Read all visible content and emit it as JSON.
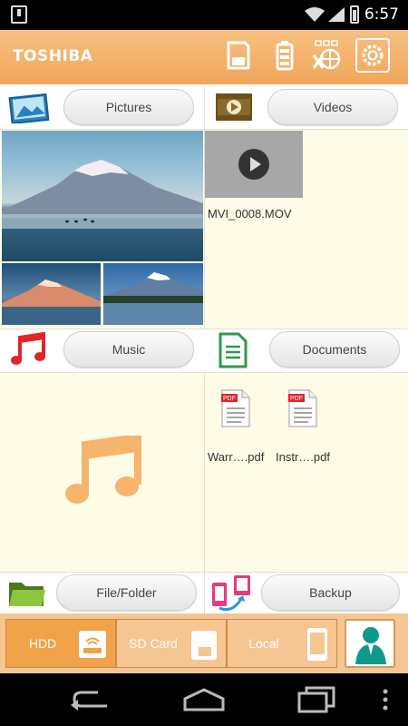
{
  "status_bar": {
    "time": "6:57"
  },
  "app_bar": {
    "brand": "TOSHIBA",
    "icons": [
      "sd-card-icon",
      "battery-icon",
      "wifi-globe-icon",
      "settings-icon"
    ]
  },
  "sections": {
    "pictures": {
      "label": "Pictures",
      "icon": "pictures-icon"
    },
    "videos": {
      "label": "Videos",
      "icon": "videos-icon",
      "files": [
        "MVI_0008.MOV"
      ]
    },
    "music": {
      "label": "Music",
      "icon": "music-icon"
    },
    "documents": {
      "label": "Documents",
      "icon": "documents-icon",
      "files": [
        "Warr….pdf",
        "Instr….pdf"
      ]
    },
    "file_folder": {
      "label": "File/Folder",
      "icon": "folder-icon"
    },
    "backup": {
      "label": "Backup",
      "icon": "backup-icon"
    }
  },
  "bottom_tabs": [
    {
      "label": "HDD",
      "icon": "hdd-wireless-icon"
    },
    {
      "label": "SD Card",
      "icon": "sd-card-icon"
    },
    {
      "label": "Local",
      "icon": "phone-icon"
    }
  ],
  "colors": {
    "accent": "#f0a65a",
    "panel": "#fefbe6",
    "music_note": "#f5b56c"
  }
}
